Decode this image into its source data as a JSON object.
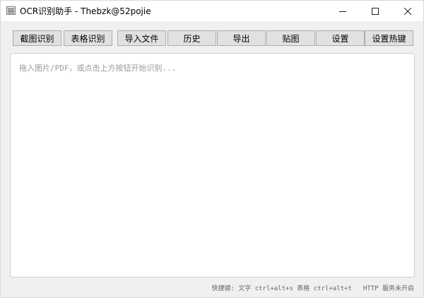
{
  "window": {
    "title": "OCR识别助手 - Thebzk@52pojie",
    "controls": {
      "minimize_icon": "minimize-icon",
      "maximize_icon": "maximize-icon",
      "close_icon": "close-icon"
    }
  },
  "toolbar": {
    "buttons": [
      {
        "label": "截图识别"
      },
      {
        "label": "表格识别"
      },
      {
        "label": "导入文件"
      },
      {
        "label": "历史"
      },
      {
        "label": "导出"
      },
      {
        "label": "贴图"
      },
      {
        "label": "设置"
      },
      {
        "label": "设置热键"
      }
    ]
  },
  "editor": {
    "placeholder": "拖入图片/PDF，或点击上方按钮开始识别..."
  },
  "status": {
    "hotkeys": "快捷键: 文字 ctrl+alt+s  表格 ctrl+alt+t",
    "http": "HTTP 服务未开启"
  },
  "colors": {
    "window_bg": "#f0f0f0",
    "button_bg": "#e1e1e1",
    "button_border": "#adadad",
    "editor_bg": "#ffffff"
  }
}
